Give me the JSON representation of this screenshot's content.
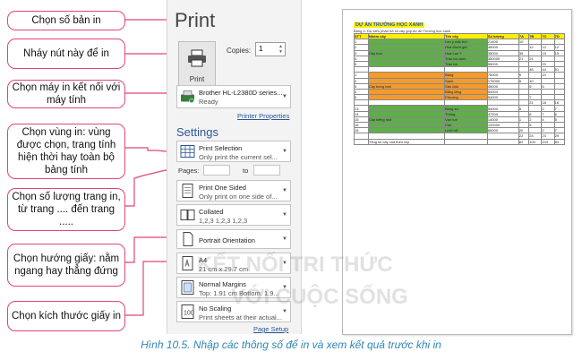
{
  "callouts": [
    {
      "text": "Chọn số bản in"
    },
    {
      "text": "Nháy nút này để in"
    },
    {
      "text": "Chọn máy in kết nối với máy tính"
    },
    {
      "text": "Chọn vùng in: vùng được chọn, trang tính hiện thời hay toàn bộ bảng tính"
    },
    {
      "text": "Chọn số lượng trang in, từ trang .... đến trang ....."
    },
    {
      "text": "Chọn hướng giấy: nằm ngang hay thẳng đứng"
    },
    {
      "text": "Chọn kích thước giấy in"
    }
  ],
  "panel": {
    "title": "Print",
    "print_button": "Print",
    "copies_label": "Copies:",
    "copies_value": "1",
    "printer_name": "Brother HL-L2380D series...",
    "printer_status": "Ready",
    "printer_properties": "Printer Properties",
    "settings_heading": "Settings",
    "print_what": {
      "line1": "Print Selection",
      "line2": "Only print the current sel..."
    },
    "pages_label": "Pages:",
    "to_label": "to",
    "sides": {
      "line1": "Print One Sided",
      "line2": "Only print on one side of..."
    },
    "collate": {
      "line1": "Collated",
      "line2": "1,2,3    1,2,3    1,2,3"
    },
    "orientation": {
      "line1": "Portrait Orientation"
    },
    "paper": {
      "line1": "A4",
      "line2": "21 cm x 29.7 cm"
    },
    "margins": {
      "line1": "Normal Margins",
      "line2": "Top: 1.91 cm Bottom: 1.9..."
    },
    "scaling": {
      "line1": "No Scaling",
      "line2": "Print sheets at their actual..."
    },
    "page_setup": "Page Setup"
  },
  "preview": {
    "title": "DỰ ÁN TRƯỜNG HỌC XANH",
    "subtitle": "Bảng 4. Dự kiến phân bổ số cây góp dự án Trường học xanh",
    "headers": [
      "STT",
      "Nhóm cây",
      "Tên cây",
      "Số lượng",
      "7A",
      "7B",
      "7C",
      "7D"
    ],
    "rows": [
      [
        "1",
        "",
        "Lan ý mặt trời",
        "21400",
        "10",
        "",
        "",
        ""
      ],
      [
        "2",
        "",
        "Hoa Mười giờ",
        "45000",
        "",
        "12",
        "12",
        "12"
      ],
      [
        "3",
        "Cây hoa",
        "Hoa Lan Ý",
        "35000",
        "35",
        "",
        "15",
        "15"
      ],
      [
        "4",
        "",
        "Trầu bà cảnh",
        "350000",
        "21",
        "21",
        "",
        ""
      ],
      [
        "5",
        "",
        "Trầu bà",
        "55000",
        "",
        "",
        "20",
        ""
      ],
      [
        "",
        "",
        "",
        "",
        "",
        "48",
        "44",
        "51"
      ],
      [
        "1",
        "",
        "Bàng",
        "75000",
        "9",
        "",
        "10",
        ""
      ],
      [
        "2",
        "",
        "Sanh",
        "175000",
        "5",
        "10",
        "",
        ""
      ],
      [
        "3",
        "Cây bóng mát",
        "Sấu dấu",
        "45000",
        "",
        "5",
        "6",
        ""
      ],
      [
        "4",
        "",
        "Bằng lăng",
        "54000",
        "",
        "",
        "",
        ""
      ],
      [
        "5",
        "",
        "Phượng",
        "54000",
        "",
        "7",
        "",
        ""
      ],
      [
        "",
        "",
        "",
        "",
        "",
        "21",
        "18",
        "16"
      ],
      [
        "13",
        "",
        "Bông sứ",
        "54000",
        "5",
        "",
        "2",
        "7"
      ],
      [
        "14",
        "",
        "Thông",
        "47000",
        "",
        "6",
        "7",
        "6"
      ],
      [
        "15",
        "Cây kiểng nhỏ",
        "Vạn tuế",
        "14000",
        "1",
        "2",
        "4",
        "5"
      ],
      [
        "16",
        "",
        "Cau",
        "120000",
        "",
        "5",
        "",
        ""
      ],
      [
        "18",
        "",
        "Lưỡi hổ",
        "65000",
        "20",
        "",
        "2",
        "7"
      ],
      [
        "",
        "",
        "",
        "",
        "22",
        "23",
        "23",
        "29"
      ],
      [
        "",
        "Tổng số cây của theo lớp",
        "",
        "",
        "62",
        "100",
        "104",
        "84"
      ]
    ]
  },
  "caption": "Hình 10.5. Nhập các thông số để in và xem kết quả trước khi in",
  "watermark": {
    "line1": "KẾT NỐI TRI THỨC",
    "line2": "VỚI CUỘC SỐNG"
  },
  "colors": {
    "callout_border": "#e0457b",
    "accent": "#2b5797",
    "caption": "#2e86b5",
    "orange": "#f39a2b",
    "green": "#5fae4a",
    "yellow": "#ffee00"
  }
}
